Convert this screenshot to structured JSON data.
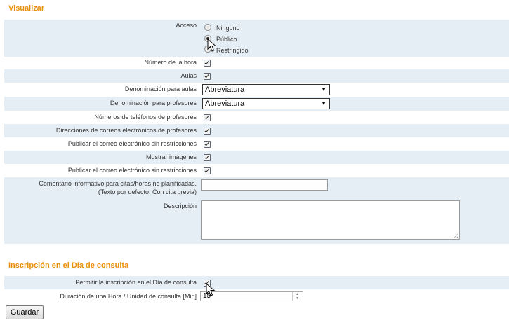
{
  "sections": {
    "visualizar_title": "Visualizar",
    "inscripcion_title": "Inscripción en el Día de consulta"
  },
  "acceso": {
    "label": "Acceso",
    "options": [
      "Ninguno",
      "Público",
      "Restringido"
    ],
    "selected": "Público"
  },
  "fields": {
    "numero_hora": "Número de la hora",
    "aulas": "Aulas",
    "denominacion_aulas": "Denominación para aulas",
    "denominacion_aulas_value": "Abreviatura",
    "denominacion_profesores": "Denominación para profesores",
    "denominacion_profesores_value": "Abreviatura",
    "telefonos": "Números de teléfonos de profesores",
    "correos": "Direcciones de correos electrónicos de profesores",
    "publicar_correo_1": "Publicar el correo electrónico sin restricciones",
    "mostrar_imagenes": "Mostrar imágenes",
    "publicar_correo_2": "Publicar el correo electrónico sin restricciones",
    "comentario_line1": "Comentario informativo para citas/horas no planificadas.",
    "comentario_line2": "(Texto por defecto: Con cita previa)",
    "comentario_value": "",
    "descripcion": "Descripción",
    "descripcion_value": ""
  },
  "inscripcion": {
    "permitir": "Permitir la inscripción en el Día de consulta",
    "duracion": "Duración de una Hora / Unidad de consulta [Min]",
    "duracion_value": "15"
  },
  "checkboxes_checked": true,
  "save_label": "Guardar",
  "colors": {
    "accent": "#e8900c",
    "row_shade": "#e6eef5"
  }
}
